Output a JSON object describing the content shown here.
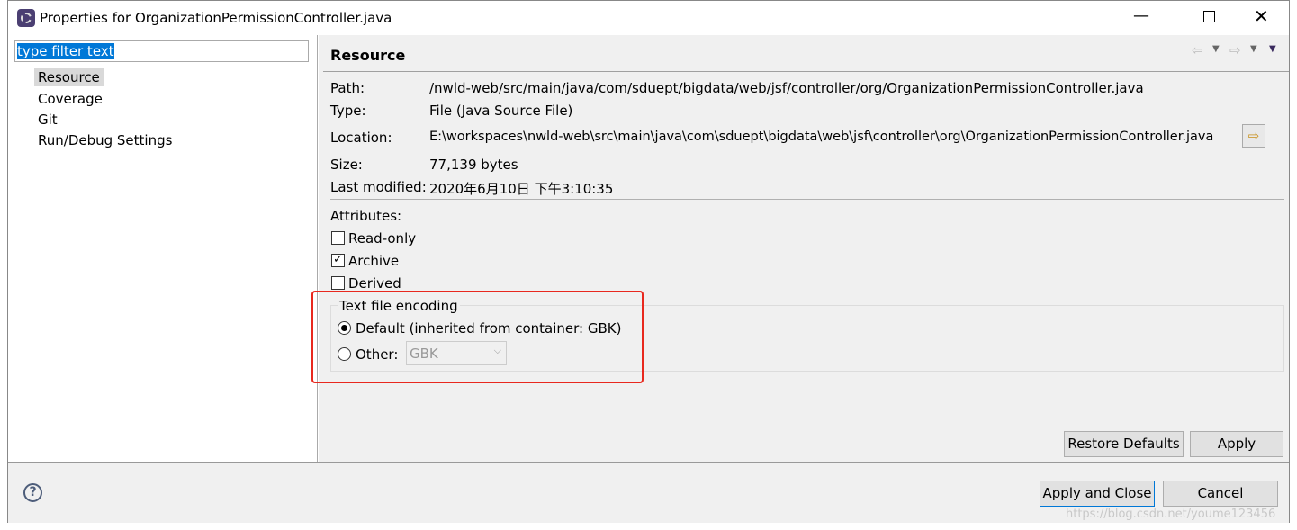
{
  "window": {
    "title": "Properties for OrganizationPermissionController.java"
  },
  "filter": {
    "value": "type filter text"
  },
  "tree": [
    {
      "label": "Resource"
    },
    {
      "label": "Coverage"
    },
    {
      "label": "Git"
    },
    {
      "label": "Run/Debug Settings"
    }
  ],
  "page": {
    "title": "Resource",
    "path_label": "Path:",
    "path": "/nwld-web/src/main/java/com/sduept/bigdata/web/jsf/controller/org/OrganizationPermissionController.java",
    "type_label": "Type:",
    "type": "File  (Java Source File)",
    "location_label": "Location:",
    "location": "E:\\workspaces\\nwld-web\\src\\main\\java\\com\\sduept\\bigdata\\web\\jsf\\controller\\org\\OrganizationPermissionController.java",
    "size_label": "Size:",
    "size": "77,139  bytes",
    "modified_label": "Last modified:",
    "modified": "2020年6月10日 下午3:10:35",
    "attributes_label": "Attributes:",
    "attrs": [
      {
        "label": "Read-only",
        "checked": false
      },
      {
        "label": "Archive",
        "checked": true
      },
      {
        "label": "Derived",
        "checked": false
      }
    ],
    "encoding": {
      "legend": "Text file encoding",
      "default_label": "Default (inherited from container: GBK)",
      "other_label": "Other:",
      "other_value": "GBK",
      "selected": "default"
    },
    "restore_defaults": "Restore Defaults",
    "apply": "Apply"
  },
  "footer": {
    "apply_close": "Apply and Close",
    "cancel": "Cancel"
  },
  "watermark": "https://blog.csdn.net/youme123456",
  "colors": {
    "highlight": "#0078d7",
    "annotation": "#e8281e"
  }
}
